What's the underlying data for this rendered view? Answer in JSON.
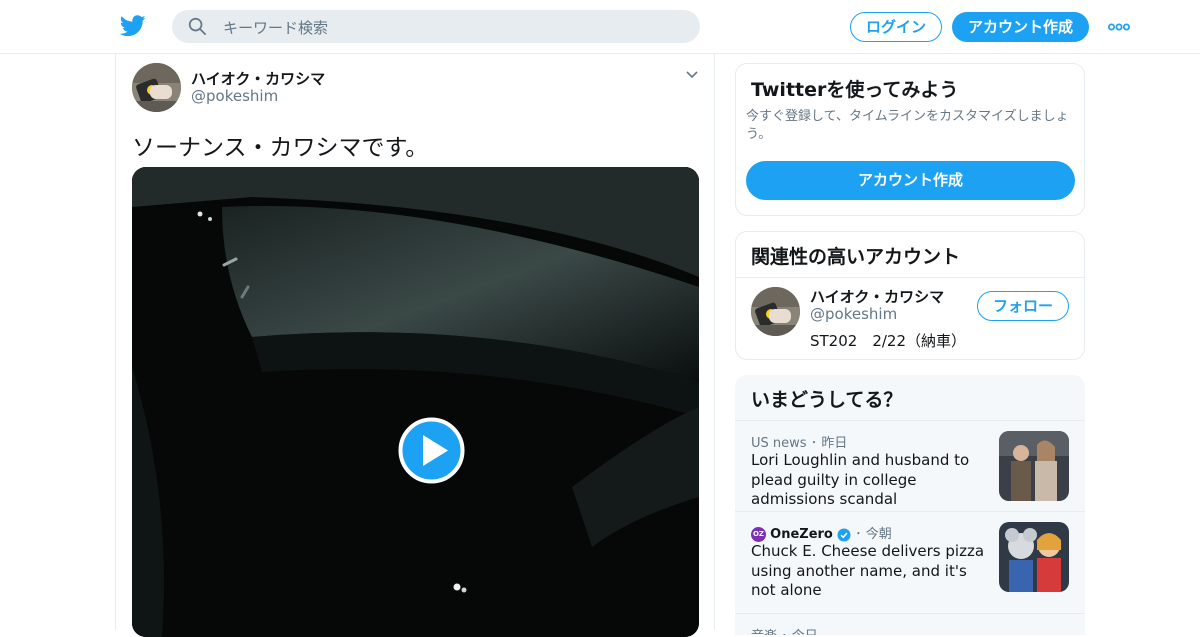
{
  "topbar": {
    "logo_icon": "twitter-bird-icon",
    "search_placeholder": "キーワード検索",
    "login_label": "ログイン",
    "signup_label": "アカウント作成",
    "more_icon": "more-dots-icon"
  },
  "tweet": {
    "author_name": "ハイオク・カワシマ",
    "author_handle": "@pokeshim",
    "text": "ソーナンス・カワシマです。",
    "media_type": "video",
    "play_icon": "play-icon"
  },
  "signup_card": {
    "title": "Twitterを使ってみよう",
    "description": "今すぐ登録して、タイムラインをカスタマイズしましょう。",
    "button_label": "アカウント作成"
  },
  "related_card": {
    "title": "関連性の高いアカウント",
    "account": {
      "name": "ハイオク・カワシマ",
      "handle": "@pokeshim",
      "bio": "ST202　2/22（納車）",
      "follow_label": "フォロー"
    }
  },
  "trends_card": {
    "title": "いまどうしてる？",
    "items": [
      {
        "category": "US news",
        "time": "昨日",
        "text": "Lori Loughlin and husband to plead guilty in college admissions scandal"
      },
      {
        "source_badge": "OZ",
        "source": "OneZero",
        "verified": true,
        "time": "今朝",
        "text": "Chuck E. Cheese delivers pizza using another name, and it's not alone"
      },
      {
        "category": "音楽",
        "time": "今日"
      }
    ]
  },
  "colors": {
    "brand_blue": "#1da1f2",
    "text_primary": "#14171a",
    "text_secondary": "#657786",
    "border": "#e6ecf0"
  }
}
